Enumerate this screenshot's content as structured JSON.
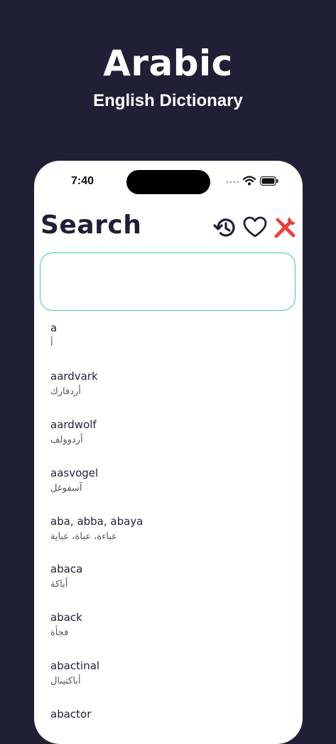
{
  "hero": {
    "title": "Arabic",
    "subtitle": "English Dictionary"
  },
  "status_bar": {
    "time": "7:40",
    "icons": [
      "signal-dots-icon",
      "wifi-icon",
      "battery-icon"
    ]
  },
  "header": {
    "title": "Search",
    "actions": [
      {
        "icon": "history-icon",
        "color": "#1f1f36"
      },
      {
        "icon": "heart-icon",
        "color": "#1f1f36"
      },
      {
        "icon": "tools-icon",
        "color": "#e8403a"
      }
    ]
  },
  "search": {
    "value": "",
    "border_color": "#3dcf9f"
  },
  "words": [
    {
      "en": "a",
      "ar": "أ"
    },
    {
      "en": "aardvark",
      "ar": "أردفارك"
    },
    {
      "en": "aardwolf",
      "ar": "أردوولف"
    },
    {
      "en": "aasvogel",
      "ar": "آسفوغل"
    },
    {
      "en": "aba, abba, abaya",
      "ar": "عباءة، عباة، عباية"
    },
    {
      "en": "abaca",
      "ar": "أباكة"
    },
    {
      "en": "aback",
      "ar": "فجأة"
    },
    {
      "en": "abactinal",
      "ar": "أباكتينال"
    },
    {
      "en": "abactor",
      "ar": ""
    }
  ],
  "colors": {
    "background": "#1f1f36",
    "card": "#ffffff",
    "accent": "#3dcf9f",
    "danger": "#e8403a"
  }
}
